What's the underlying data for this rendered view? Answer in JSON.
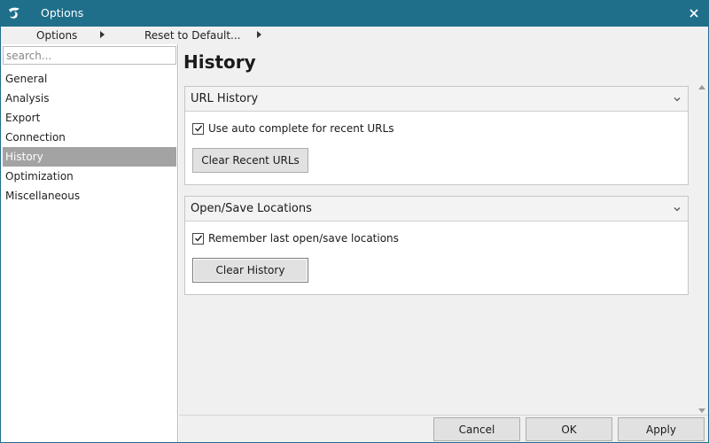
{
  "window": {
    "title": "Options",
    "accent_color": "#1f6f8b",
    "app_icon": "app-logo-icon",
    "close_icon": "close-icon"
  },
  "toolbar": {
    "options_label": "Options",
    "reset_label": "Reset to Default..."
  },
  "sidebar": {
    "search_placeholder": "search...",
    "items": [
      {
        "label": "General",
        "selected": false
      },
      {
        "label": "Analysis",
        "selected": false
      },
      {
        "label": "Export",
        "selected": false
      },
      {
        "label": "Connection",
        "selected": false
      },
      {
        "label": "History",
        "selected": true
      },
      {
        "label": "Optimization",
        "selected": false
      },
      {
        "label": "Miscellaneous",
        "selected": false
      }
    ]
  },
  "main": {
    "title": "History",
    "groups": [
      {
        "header": "URL History",
        "checkbox_label": "Use auto complete for recent URLs",
        "checked": true,
        "button_label": "Clear Recent URLs"
      },
      {
        "header": "Open/Save Locations",
        "checkbox_label": "Remember last open/save locations",
        "checked": true,
        "button_label": "Clear History"
      }
    ]
  },
  "footer": {
    "cancel_label": "Cancel",
    "ok_label": "OK",
    "apply_label": "Apply"
  }
}
